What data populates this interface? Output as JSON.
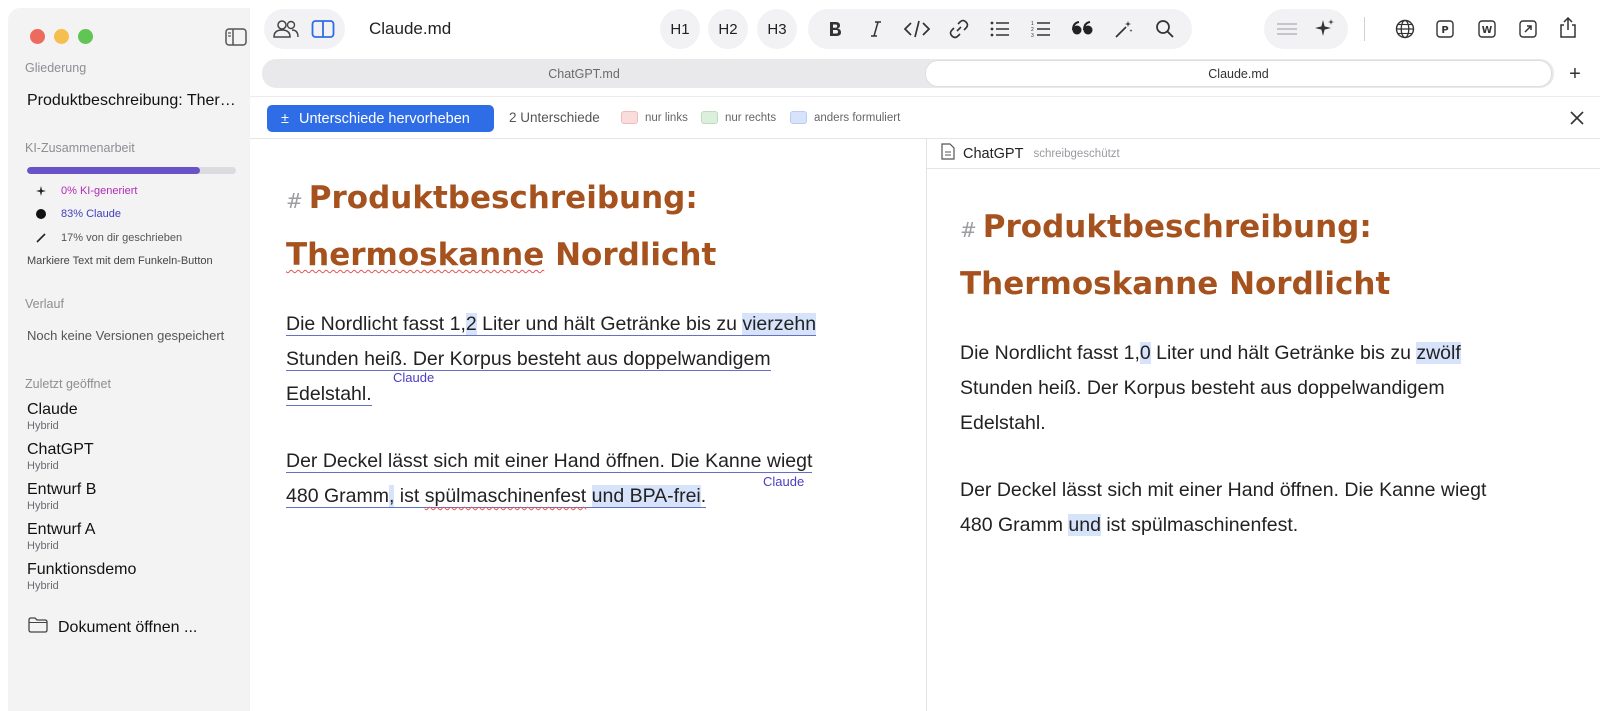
{
  "window": {
    "title": "Claude.md"
  },
  "sidebar": {
    "outline_label": "Gliederung",
    "outline_item": "Produktbeschreibung: Thermoskanne Nordlicht",
    "ai_label": "KI-Zusammenarbeit",
    "ai_progress_fraction": 0.83,
    "stats": {
      "ai_generated": "0% KI-generiert",
      "claude": "83% Claude",
      "self_written": "17% von dir geschrieben"
    },
    "hint": "Markiere Text mit dem Funkeln-Button",
    "history_label": "Verlauf",
    "no_versions": "Noch keine Versionen gespeichert",
    "recent_label": "Zuletzt geöffnet",
    "recent": [
      {
        "name": "Claude",
        "mode": "Hybrid"
      },
      {
        "name": "ChatGPT",
        "mode": "Hybrid"
      },
      {
        "name": "Entwurf B",
        "mode": "Hybrid"
      },
      {
        "name": "Entwurf A",
        "mode": "Hybrid"
      },
      {
        "name": "Funktionsdemo",
        "mode": "Hybrid"
      }
    ],
    "open_document": "Dokument öffnen ..."
  },
  "toolbar": {
    "title": "Claude.md",
    "h1": "H1",
    "h2": "H2",
    "h3": "H3"
  },
  "tabs": [
    {
      "label": "ChatGPT.md",
      "active": false
    },
    {
      "label": "Claude.md",
      "active": true
    }
  ],
  "diffbar": {
    "button_label": "Unterschiede hervorheben",
    "button_icon": "±",
    "count": "2 Unterschiede",
    "legend": {
      "left_only": "nur links",
      "right_only": "nur rechts",
      "reworded": "anders formuliert"
    },
    "colors": {
      "left_only": "#fbdcdc",
      "right_only": "#dcefdc",
      "reworded": "#d6e3fb"
    }
  },
  "left_doc": {
    "heading_line1": "Produktbeschreibung:",
    "heading_line2a": "Thermoskanne",
    "heading_line2b": " Nordlicht",
    "p1": {
      "a": "Die Nordlicht fasst 1,",
      "b": "2",
      "c": " Liter und hält Getränke bis zu ",
      "d": "vierzehn",
      "e": "Stunden heiß. Der Korpus besteht aus doppelwandigem",
      "f": "Edelstahl."
    },
    "p1_tag": "Claude",
    "p2": {
      "a": "Der Deckel lässt sich mit einer Hand öffnen. Die Kanne wiegt",
      "b": "480 Gramm",
      "c": ",",
      "d": " ist ",
      "e": "spülmaschinenfest",
      "f": " ",
      "g": "und BPA-frei",
      "h": "."
    },
    "p2_tag": "Claude"
  },
  "right_doc": {
    "pane_name": "ChatGPT",
    "pane_status": "schreibgeschützt",
    "heading_line1": "Produktbeschreibung:",
    "heading_line2": "Thermoskanne Nordlicht",
    "p1": {
      "a": "Die Nordlicht fasst 1,",
      "b": "0",
      "c": " Liter und hält Getränke bis zu ",
      "d": "zwölf",
      "e": "Stunden heiß. Der Korpus besteht aus doppelwandigem",
      "f": "Edelstahl."
    },
    "p2": {
      "a": "Der Deckel lässt sich mit einer Hand öffnen. Die Kanne wiegt",
      "b": "480 Gramm ",
      "c": "und",
      "d": " ist spülmaschinenfest."
    }
  }
}
